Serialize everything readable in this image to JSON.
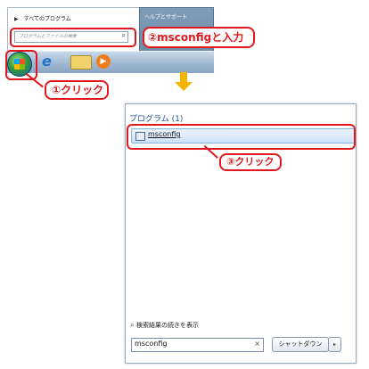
{
  "top_menu": {
    "all_programs": "すべてのプログラム",
    "help": "ヘルプとサポート",
    "search_placeholder": "プログラムとファイルの検索"
  },
  "callouts": {
    "step1": "①クリック",
    "step2": "②msconfigと入力",
    "step3": "③クリック"
  },
  "start_menu": {
    "programs_header": "プログラム (1)",
    "result_item": "msconfig",
    "see_more": "検索結果の続きを表示",
    "search_value": "msconfig",
    "clear": "×",
    "shutdown": "シャットダウン",
    "shutdown_arrow": "▸"
  },
  "icons": [
    "start-orb-icon",
    "ie-icon",
    "folder-icon",
    "media-player-icon",
    "search-icon",
    "arrow-down-icon"
  ],
  "colors": {
    "highlight_red": "#e0191e",
    "arrow_yellow": "#f5b400",
    "selection_blue": "#cde2f8"
  }
}
